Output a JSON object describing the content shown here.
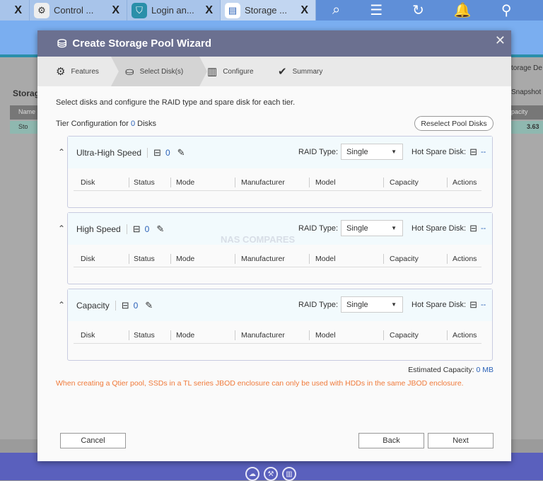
{
  "taskbar": {
    "tabs": [
      {
        "label": "Control ...",
        "icon": "gear-icon"
      },
      {
        "label": "Login an...",
        "icon": "shield-icon"
      },
      {
        "label": "Storage ...",
        "icon": "storage-icon"
      }
    ],
    "close_label": "X",
    "icons": [
      "search-icon",
      "tasks-icon",
      "backup-icon",
      "bell-icon",
      "user-icon"
    ]
  },
  "background": {
    "storage_title": "Storag",
    "name_header": "Name",
    "row_name": "Sto",
    "storage_btn": "torage De",
    "snapshot_btn": "Snapshot",
    "capacity_header": "pacity",
    "capacity_value": "3.63"
  },
  "wizard": {
    "title": "Create Storage Pool Wizard",
    "steps": [
      {
        "label": "Features",
        "icon": "gear-icon"
      },
      {
        "label": "Select Disk(s)",
        "icon": "disk-icon",
        "active": true
      },
      {
        "label": "Configure",
        "icon": "configure-icon"
      },
      {
        "label": "Summary",
        "icon": "check-circle-icon"
      }
    ],
    "intro": "Select disks and configure the RAID type and spare disk for each tier.",
    "tier_config_prefix": "Tier Configuration for ",
    "tier_config_count": "0",
    "tier_config_suffix": " Disks",
    "reselect_label": "Reselect Pool Disks",
    "raid_label": "RAID Type:",
    "spare_label": "Hot Spare Disk:",
    "spare_value": "--",
    "columns": [
      "Disk",
      "Status",
      "Mode",
      "Manufacturer",
      "Model",
      "Capacity",
      "Actions"
    ],
    "tiers": [
      {
        "name": "Ultra-High Speed",
        "count": "0",
        "raid": "Single"
      },
      {
        "name": "High Speed",
        "count": "0",
        "raid": "Single"
      },
      {
        "name": "Capacity",
        "count": "0",
        "raid": "Single"
      }
    ],
    "est_label": "Estimated Capacity: ",
    "est_value": "0 MB",
    "warning": "When creating a Qtier pool, SSDs in a TL series JBOD enclosure can only be used with HDDs in the same JBOD enclosure.",
    "cancel": "Cancel",
    "back": "Back",
    "next": "Next",
    "watermark": "NAS COMPARES"
  },
  "colors": {
    "title_bar": "#6b7090",
    "accent": "#2b62b8",
    "warning": "#f07a3a"
  }
}
